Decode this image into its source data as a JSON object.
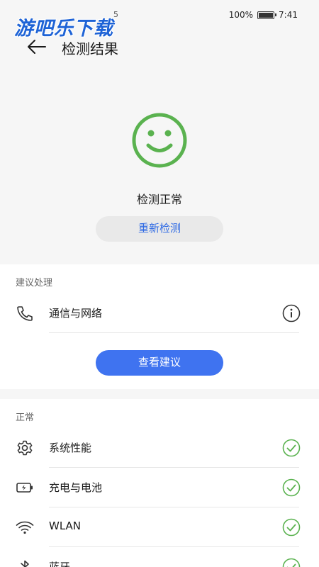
{
  "status_bar": {
    "left_text": "5",
    "battery_percent": "100%",
    "time": "7:41"
  },
  "watermark": {
    "text": "游吧乐下载"
  },
  "header": {
    "title": "检测结果"
  },
  "hero": {
    "result": "检测正常",
    "retest_label": "重新检测"
  },
  "suggestions": {
    "section_label": "建议处理",
    "items": [
      {
        "label": "通信与网络",
        "icon": "phone-icon",
        "end_icon": "info-icon"
      }
    ],
    "view_button": "查看建议"
  },
  "normal": {
    "section_label": "正常",
    "items": [
      {
        "label": "系统性能",
        "icon": "gear-icon",
        "status_icon": "check-icon"
      },
      {
        "label": "充电与电池",
        "icon": "battery-icon",
        "status_icon": "check-icon"
      },
      {
        "label": "WLAN",
        "icon": "wifi-icon",
        "status_icon": "check-icon"
      },
      {
        "label": "蓝牙",
        "icon": "bluetooth-icon",
        "status_icon": "check-icon"
      }
    ]
  },
  "colors": {
    "accent_blue": "#3f73f0",
    "ok_green": "#5ab24f"
  }
}
